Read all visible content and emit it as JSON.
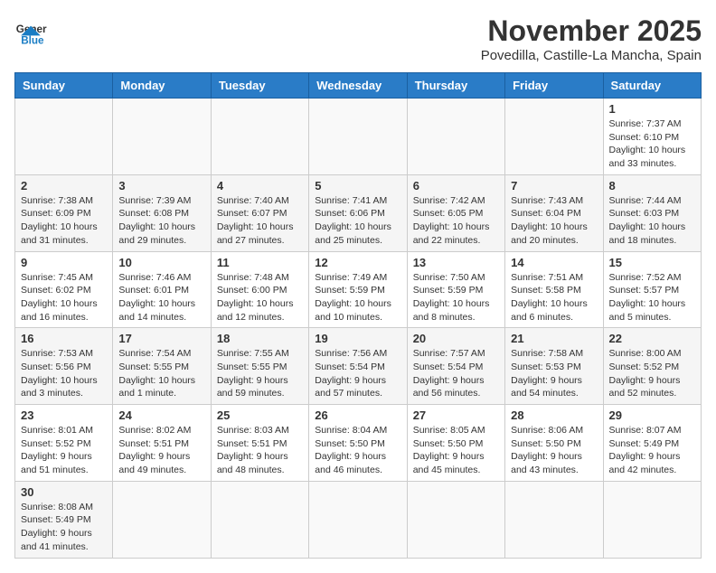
{
  "header": {
    "logo_general": "General",
    "logo_blue": "Blue",
    "month_title": "November 2025",
    "subtitle": "Povedilla, Castille-La Mancha, Spain"
  },
  "weekdays": [
    "Sunday",
    "Monday",
    "Tuesday",
    "Wednesday",
    "Thursday",
    "Friday",
    "Saturday"
  ],
  "weeks": [
    [
      {
        "day": "",
        "info": ""
      },
      {
        "day": "",
        "info": ""
      },
      {
        "day": "",
        "info": ""
      },
      {
        "day": "",
        "info": ""
      },
      {
        "day": "",
        "info": ""
      },
      {
        "day": "",
        "info": ""
      },
      {
        "day": "1",
        "info": "Sunrise: 7:37 AM\nSunset: 6:10 PM\nDaylight: 10 hours\nand 33 minutes."
      }
    ],
    [
      {
        "day": "2",
        "info": "Sunrise: 7:38 AM\nSunset: 6:09 PM\nDaylight: 10 hours\nand 31 minutes."
      },
      {
        "day": "3",
        "info": "Sunrise: 7:39 AM\nSunset: 6:08 PM\nDaylight: 10 hours\nand 29 minutes."
      },
      {
        "day": "4",
        "info": "Sunrise: 7:40 AM\nSunset: 6:07 PM\nDaylight: 10 hours\nand 27 minutes."
      },
      {
        "day": "5",
        "info": "Sunrise: 7:41 AM\nSunset: 6:06 PM\nDaylight: 10 hours\nand 25 minutes."
      },
      {
        "day": "6",
        "info": "Sunrise: 7:42 AM\nSunset: 6:05 PM\nDaylight: 10 hours\nand 22 minutes."
      },
      {
        "day": "7",
        "info": "Sunrise: 7:43 AM\nSunset: 6:04 PM\nDaylight: 10 hours\nand 20 minutes."
      },
      {
        "day": "8",
        "info": "Sunrise: 7:44 AM\nSunset: 6:03 PM\nDaylight: 10 hours\nand 18 minutes."
      }
    ],
    [
      {
        "day": "9",
        "info": "Sunrise: 7:45 AM\nSunset: 6:02 PM\nDaylight: 10 hours\nand 16 minutes."
      },
      {
        "day": "10",
        "info": "Sunrise: 7:46 AM\nSunset: 6:01 PM\nDaylight: 10 hours\nand 14 minutes."
      },
      {
        "day": "11",
        "info": "Sunrise: 7:48 AM\nSunset: 6:00 PM\nDaylight: 10 hours\nand 12 minutes."
      },
      {
        "day": "12",
        "info": "Sunrise: 7:49 AM\nSunset: 5:59 PM\nDaylight: 10 hours\nand 10 minutes."
      },
      {
        "day": "13",
        "info": "Sunrise: 7:50 AM\nSunset: 5:59 PM\nDaylight: 10 hours\nand 8 minutes."
      },
      {
        "day": "14",
        "info": "Sunrise: 7:51 AM\nSunset: 5:58 PM\nDaylight: 10 hours\nand 6 minutes."
      },
      {
        "day": "15",
        "info": "Sunrise: 7:52 AM\nSunset: 5:57 PM\nDaylight: 10 hours\nand 5 minutes."
      }
    ],
    [
      {
        "day": "16",
        "info": "Sunrise: 7:53 AM\nSunset: 5:56 PM\nDaylight: 10 hours\nand 3 minutes."
      },
      {
        "day": "17",
        "info": "Sunrise: 7:54 AM\nSunset: 5:55 PM\nDaylight: 10 hours\nand 1 minute."
      },
      {
        "day": "18",
        "info": "Sunrise: 7:55 AM\nSunset: 5:55 PM\nDaylight: 9 hours\nand 59 minutes."
      },
      {
        "day": "19",
        "info": "Sunrise: 7:56 AM\nSunset: 5:54 PM\nDaylight: 9 hours\nand 57 minutes."
      },
      {
        "day": "20",
        "info": "Sunrise: 7:57 AM\nSunset: 5:54 PM\nDaylight: 9 hours\nand 56 minutes."
      },
      {
        "day": "21",
        "info": "Sunrise: 7:58 AM\nSunset: 5:53 PM\nDaylight: 9 hours\nand 54 minutes."
      },
      {
        "day": "22",
        "info": "Sunrise: 8:00 AM\nSunset: 5:52 PM\nDaylight: 9 hours\nand 52 minutes."
      }
    ],
    [
      {
        "day": "23",
        "info": "Sunrise: 8:01 AM\nSunset: 5:52 PM\nDaylight: 9 hours\nand 51 minutes."
      },
      {
        "day": "24",
        "info": "Sunrise: 8:02 AM\nSunset: 5:51 PM\nDaylight: 9 hours\nand 49 minutes."
      },
      {
        "day": "25",
        "info": "Sunrise: 8:03 AM\nSunset: 5:51 PM\nDaylight: 9 hours\nand 48 minutes."
      },
      {
        "day": "26",
        "info": "Sunrise: 8:04 AM\nSunset: 5:50 PM\nDaylight: 9 hours\nand 46 minutes."
      },
      {
        "day": "27",
        "info": "Sunrise: 8:05 AM\nSunset: 5:50 PM\nDaylight: 9 hours\nand 45 minutes."
      },
      {
        "day": "28",
        "info": "Sunrise: 8:06 AM\nSunset: 5:50 PM\nDaylight: 9 hours\nand 43 minutes."
      },
      {
        "day": "29",
        "info": "Sunrise: 8:07 AM\nSunset: 5:49 PM\nDaylight: 9 hours\nand 42 minutes."
      }
    ],
    [
      {
        "day": "30",
        "info": "Sunrise: 8:08 AM\nSunset: 5:49 PM\nDaylight: 9 hours\nand 41 minutes."
      },
      {
        "day": "",
        "info": ""
      },
      {
        "day": "",
        "info": ""
      },
      {
        "day": "",
        "info": ""
      },
      {
        "day": "",
        "info": ""
      },
      {
        "day": "",
        "info": ""
      },
      {
        "day": "",
        "info": ""
      }
    ]
  ]
}
